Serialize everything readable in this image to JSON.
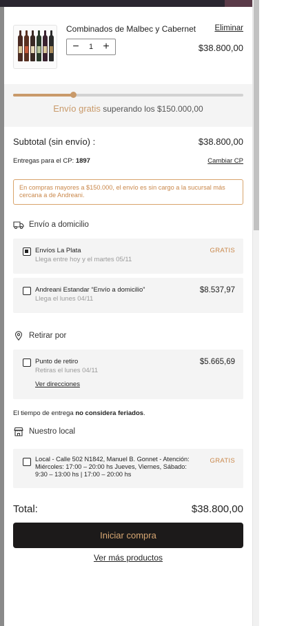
{
  "cart": {
    "item": {
      "name": "Combinados de Malbec y Cabernet",
      "remove_label": "Eliminar",
      "quantity": "1",
      "decrement_symbol": "−",
      "increment_symbol": "+",
      "price": "$38.800,00"
    },
    "free_shipping": {
      "progress": 0.26,
      "highlight": "Envío gratis",
      "text": " superando los $150.000,00"
    },
    "subtotal": {
      "label": "Subtotal (sin envío) :",
      "value": "$38.800,00"
    },
    "postal": {
      "label": "Entregas para el CP: ",
      "code": "1897",
      "change_label": "Cambiar CP"
    },
    "notice": "En compras mayores a $150.000, el envío es sin cargo a la sucursal más cercana a de Andreani."
  },
  "shipping": {
    "home_delivery": {
      "title": "Envío a domicilio",
      "icon": "truck-icon",
      "options": [
        {
          "name": "Envíos La Plata",
          "subtitle": "Llega entre hoy y el martes 05/11",
          "price": "GRATIS",
          "selected": true
        },
        {
          "name": "Andreani Estandar “Envío a domicilio”",
          "subtitle": "Llega el lunes 04/11",
          "price": "$8.537,97",
          "selected": false
        }
      ]
    },
    "pickup": {
      "title": "Retirar por",
      "icon": "location-pin-icon",
      "option": {
        "name": "Punto de retiro",
        "subtitle": "Retiras el lunes 04/11",
        "price": "$5.665,69",
        "link": "Ver direcciones",
        "selected": false
      }
    },
    "delivery_note": {
      "prefix": "El tiempo de entrega ",
      "bold": "no considera feriados",
      "suffix": "."
    },
    "store": {
      "title": "Nuestro local",
      "icon": "store-icon",
      "option": {
        "text": "Local - Calle 502 N1842, Manuel B. Gonnet - Atención: Miércoles: 17:00 – 20:00 hs Jueves, Viernes, Sábado: 9:30 – 13:00 hs | 17:00 – 20:00 hs",
        "price": "GRATIS",
        "selected": false
      }
    }
  },
  "total": {
    "label": "Total:",
    "value": "$38.800,00"
  },
  "actions": {
    "checkout_label": "Iniciar compra",
    "more_products_label": "Ver más productos"
  },
  "colors": {
    "accent": "#c99a6a",
    "button_bg": "#1c1a1a",
    "button_text": "#d9a873",
    "notice_border": "#d8a36b"
  }
}
